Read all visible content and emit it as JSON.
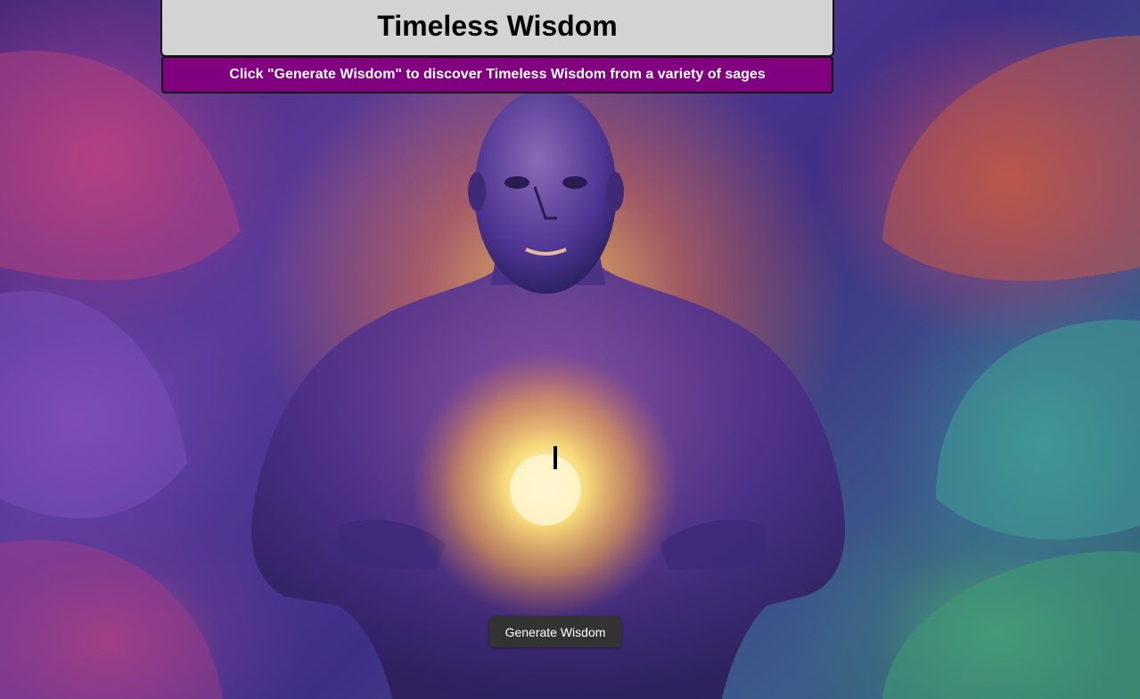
{
  "header": {
    "title": "Timeless Wisdom"
  },
  "subheader": {
    "instruction": "Click \"Generate Wisdom\" to discover Timeless Wisdom from a variety of sages"
  },
  "quote": {
    "text": ""
  },
  "actions": {
    "generate_label": "Generate Wisdom"
  },
  "colors": {
    "header_bg": "#d3d3d3",
    "subheader_bg": "#800080",
    "button_bg": "#333333",
    "button_text": "#ffffff"
  },
  "background": {
    "image_name": "meditating-figure-glowing-heart-painting"
  }
}
